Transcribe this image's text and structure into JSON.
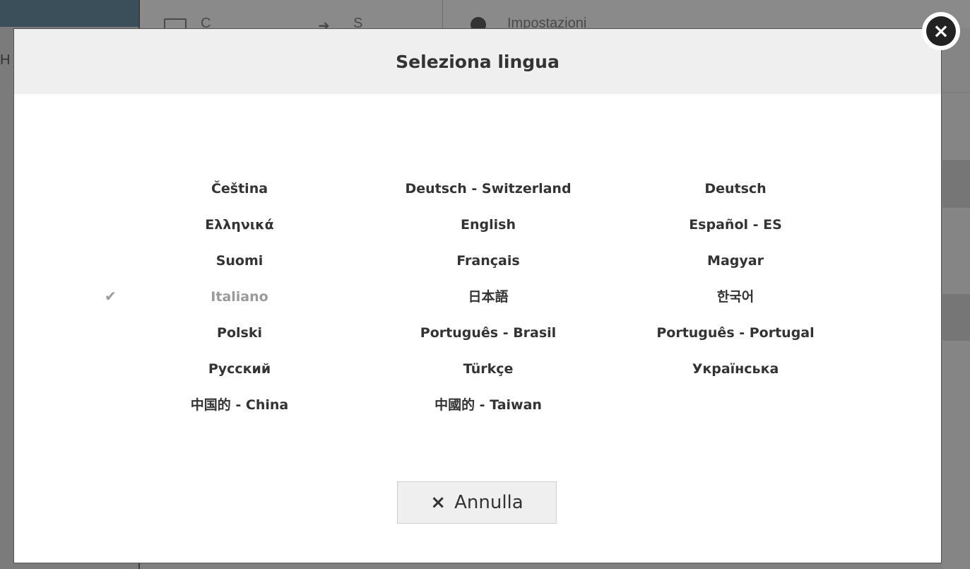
{
  "background": {
    "breadcrumb_start": "C",
    "breadcrumb_end": "S",
    "settings_title": "Impostazioni",
    "side_letter": "H"
  },
  "modal": {
    "title": "Seleziona lingua",
    "languages": [
      [
        "Čeština",
        "Deutsch - Switzerland",
        "Deutsch"
      ],
      [
        "Ελληνικά",
        "English",
        "Español - ES"
      ],
      [
        "Suomi",
        "Français",
        "Magyar"
      ],
      [
        "Italiano",
        "日本語",
        "한국어"
      ],
      [
        "Polski",
        "Português - Brasil",
        "Português - Portugal"
      ],
      [
        "Русский",
        "Türkçe",
        "Українська"
      ],
      [
        "中国的 - China",
        "中國的 - Taiwan",
        ""
      ]
    ],
    "selected_language": "Italiano",
    "selected_marker": "✔",
    "cancel_icon": "×",
    "cancel_label": "Annulla",
    "close_icon": "x-circle-icon"
  }
}
